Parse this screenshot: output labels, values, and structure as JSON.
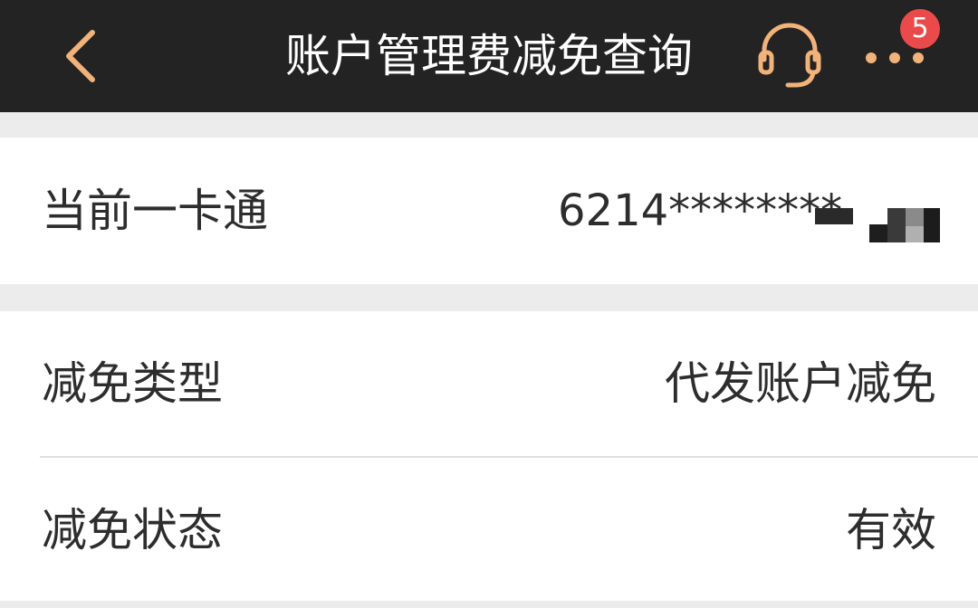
{
  "header": {
    "title": "账户管理费减免查询",
    "back_icon": "chevron-left-icon",
    "service_icon": "headset-icon",
    "more_icon": "more-dots-icon",
    "badge_count": "5",
    "accent_color": "#f2b37a",
    "bar_color": "#232323"
  },
  "card": {
    "label": "当前一卡通",
    "value": "6214********"
  },
  "details": [
    {
      "label": "减免类型",
      "value": "代发账户减免"
    },
    {
      "label": "减免状态",
      "value": "有效"
    }
  ]
}
